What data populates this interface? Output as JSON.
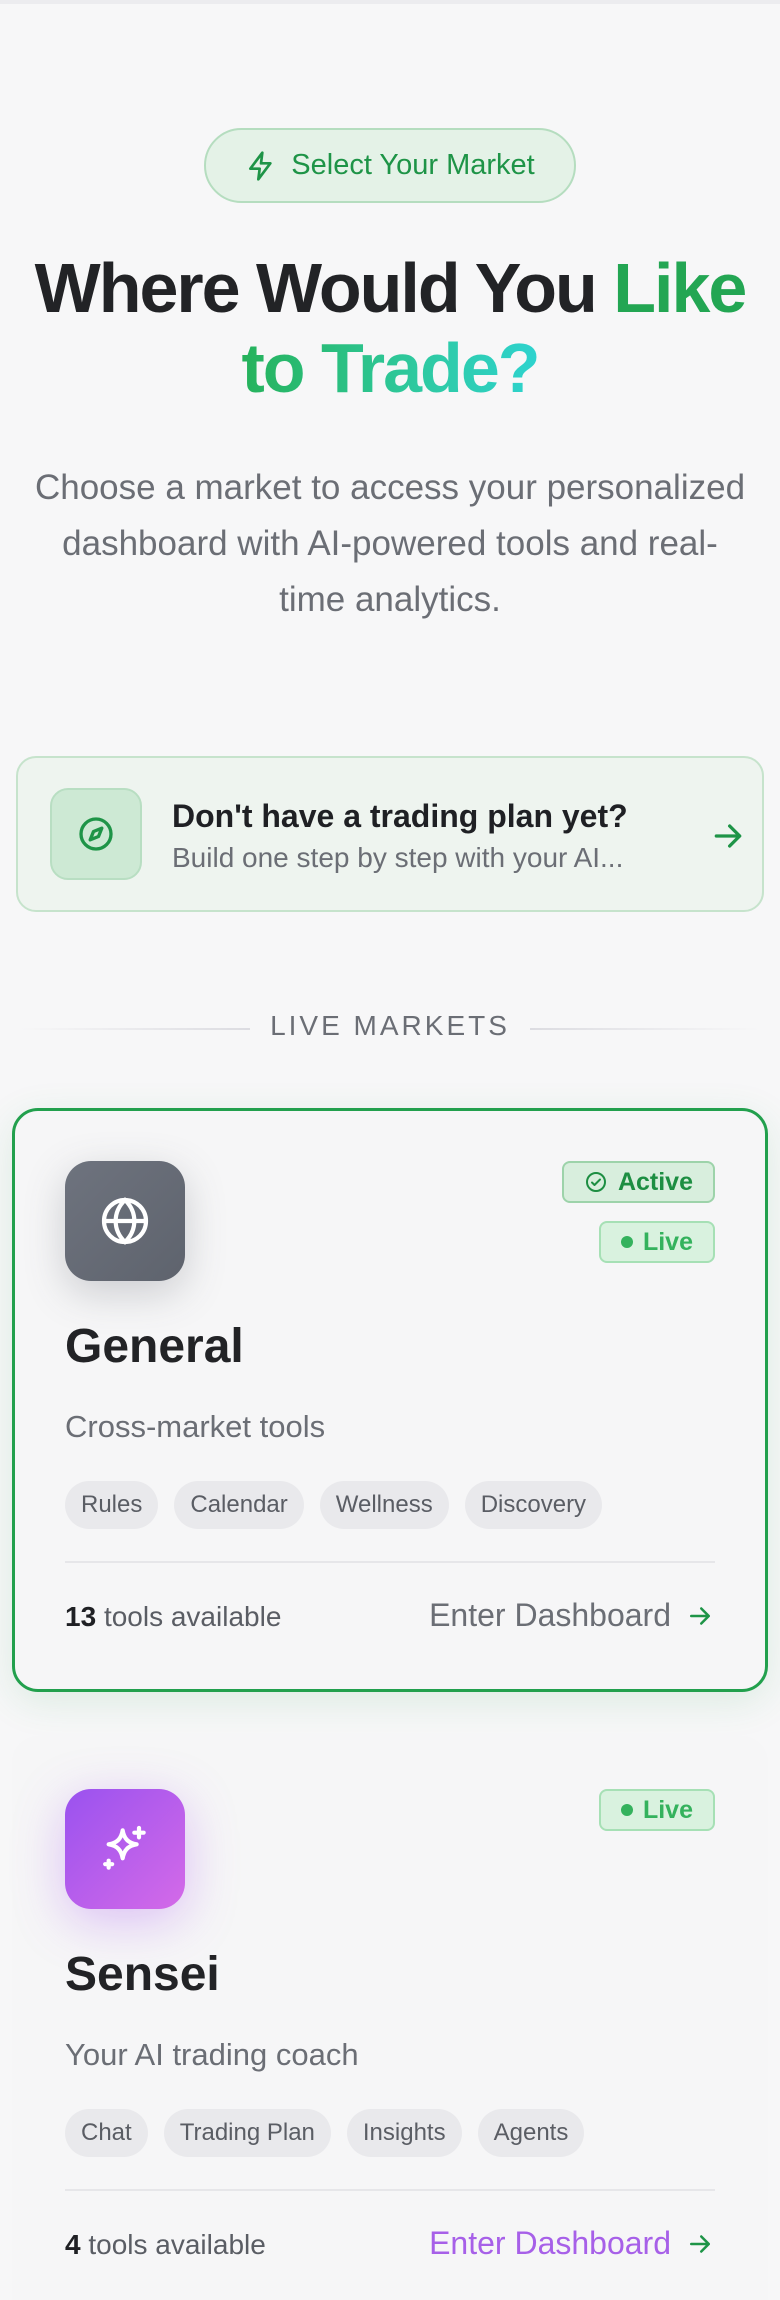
{
  "header": {
    "pill_label": "Select Your Market",
    "title_dark": "Where Would You ",
    "title_green": "Like",
    "title_gradient": "to Trade?",
    "subtitle": "Choose a market to access your personalized dashboard with AI-powered tools and real-time analytics."
  },
  "plan_banner": {
    "title": "Don't have a trading plan yet?",
    "description": "Build one step by step with your AI..."
  },
  "section_label": "LIVE MARKETS",
  "markets": [
    {
      "name": "General",
      "description": "Cross-market tools",
      "icon": "globe-icon",
      "badges": [
        "Active",
        "Live"
      ],
      "tags": [
        "Rules",
        "Calendar",
        "Wellness",
        "Discovery"
      ],
      "tools_count": "13",
      "tools_suffix": "tools available",
      "cta": "Enter Dashboard"
    },
    {
      "name": "Sensei",
      "description": "Your AI trading coach",
      "icon": "sparkles-icon",
      "badges": [
        "Live"
      ],
      "tags": [
        "Chat",
        "Trading Plan",
        "Insights",
        "Agents"
      ],
      "tools_count": "4",
      "tools_suffix": "tools available",
      "cta": "Enter Dashboard"
    }
  ],
  "colors": {
    "accent_green": "#22a04d",
    "sensei_purple": "#a760e8",
    "background": "#f7f7f8"
  }
}
